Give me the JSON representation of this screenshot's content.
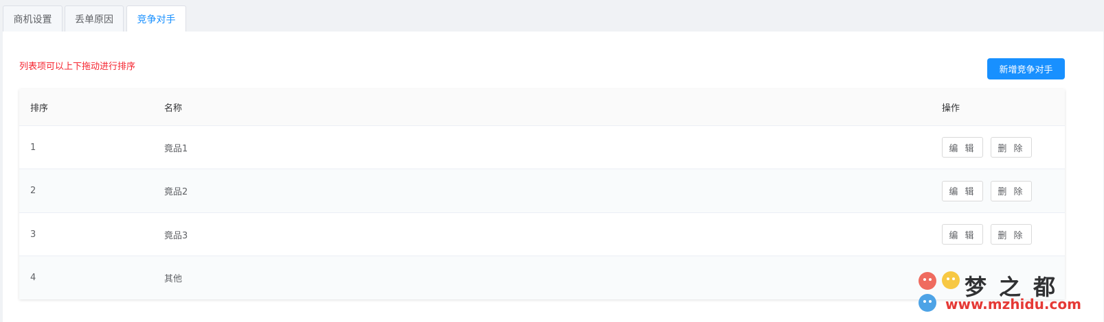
{
  "tabs": [
    {
      "label": "商机设置"
    },
    {
      "label": "丢单原因"
    },
    {
      "label": "竞争对手",
      "active": true
    }
  ],
  "hint": "列表项可以上下拖动进行排序",
  "add_button": "新增竞争对手",
  "table": {
    "headers": {
      "sort": "排序",
      "name": "名称",
      "ops": "操作"
    },
    "rows": [
      {
        "sort": "1",
        "name": "竟品1",
        "edit": "编 辑",
        "delete": "删 除"
      },
      {
        "sort": "2",
        "name": "竟品2",
        "edit": "编 辑",
        "delete": "删 除"
      },
      {
        "sort": "3",
        "name": "竟品3",
        "edit": "编 辑",
        "delete": "删 除"
      },
      {
        "sort": "4",
        "name": "其他"
      }
    ]
  },
  "watermark": {
    "title": "梦之都",
    "url": "www.mzhidu.com"
  },
  "colors": {
    "accent": "#1890ff",
    "hint": "#f5222d"
  }
}
